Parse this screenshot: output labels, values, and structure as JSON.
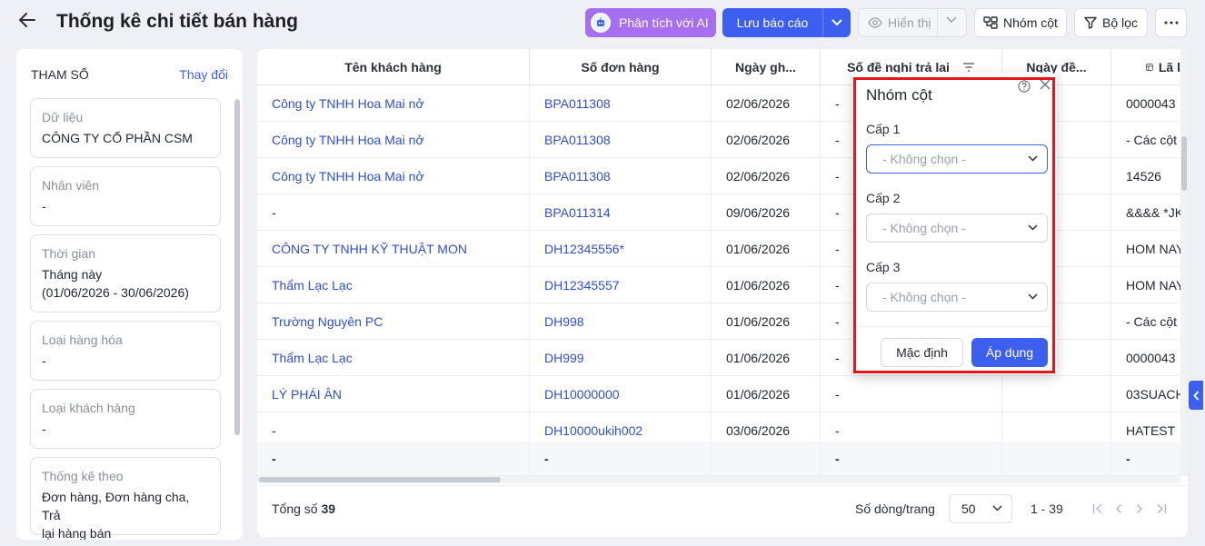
{
  "header": {
    "title": "Thống kê chi tiết bán hàng",
    "ai_button": "Phân tích với AI",
    "save_button": "Lưu báo cáo",
    "show_button": "Hiển thị",
    "group_button": "Nhóm cột",
    "filter_button": "Bộ lọc"
  },
  "params": {
    "title": "THAM SỐ",
    "change": "Thay đổi",
    "items": [
      {
        "label": "Dữ liệu",
        "value": "CÔNG TY CỔ PHẦN CSM"
      },
      {
        "label": "Nhân viên",
        "value": "-"
      },
      {
        "label": "Thời gian",
        "value": "Tháng này",
        "value2": "(01/06/2026 - 30/06/2026)"
      },
      {
        "label": "Loại hàng hóa",
        "value": "-"
      },
      {
        "label": "Loại khách hàng",
        "value": "-"
      },
      {
        "label": "Thống kê theo",
        "value": "Đơn hàng, Đơn hàng cha, Trả",
        "value2": "lại hàng bán"
      }
    ]
  },
  "table": {
    "columns": [
      "Tên khách hàng",
      "Số đơn hàng",
      "Ngày gh...",
      "Số đề nghị trả lại",
      "Ngày đề...",
      "Lã l"
    ],
    "rows": [
      [
        "Công ty TNHH Hoa Mai nở",
        "BPA011308",
        "02/06/2026",
        "-",
        "",
        "0000043"
      ],
      [
        "Công ty TNHH Hoa Mai nở",
        "BPA011308",
        "02/06/2026",
        "-",
        "",
        "- Các cột"
      ],
      [
        "Công ty TNHH Hoa Mai nở",
        "BPA011308",
        "02/06/2026",
        "-",
        "",
        "14526"
      ],
      [
        "-",
        "BPA011314",
        "09/06/2026",
        "-",
        "",
        "&&&& *JK"
      ],
      [
        "CÔNG TY TNHH KỸ THUẬT MON",
        "DH12345556*",
        "01/06/2026",
        "-",
        "",
        "HOM NAY"
      ],
      [
        "Thẩm Lạc Lạc",
        "DH12345557",
        "01/06/2026",
        "-",
        "",
        "HOM NAY"
      ],
      [
        "Trường Nguyên PC",
        "DH998",
        "01/06/2026",
        "-",
        "",
        "- Các cột"
      ],
      [
        "Thẩm Lạc Lạc",
        "DH999",
        "01/06/2026",
        "-",
        "",
        "0000043"
      ],
      [
        "LÝ PHÁI ÂN",
        "DH10000000",
        "01/06/2026",
        "-",
        "",
        "03SUACH"
      ],
      [
        "-",
        "DH10000ukih002",
        "03/06/2026",
        "-",
        "",
        "HATEST"
      ]
    ],
    "totals": [
      "-",
      "-",
      "",
      "-",
      "",
      "-"
    ]
  },
  "footer": {
    "total_label": "Tổng số",
    "total_value": "39",
    "rows_per_page_label": "Số dòng/trang",
    "rows_per_page": "50",
    "range": "1 - 39"
  },
  "popup": {
    "title": "Nhóm cột",
    "levels": [
      {
        "label": "Cấp 1",
        "placeholder": "- Không chọn -"
      },
      {
        "label": "Cấp 2",
        "placeholder": "- Không chọn -"
      },
      {
        "label": "Cấp 3",
        "placeholder": "- Không chọn -"
      }
    ],
    "default_button": "Mặc định",
    "apply_button": "Áp dụng"
  },
  "colors": {
    "primary": "#3d5ff0",
    "ai": "#a66ff0",
    "link": "#2f4fc9",
    "highlight": "#e8141c"
  }
}
